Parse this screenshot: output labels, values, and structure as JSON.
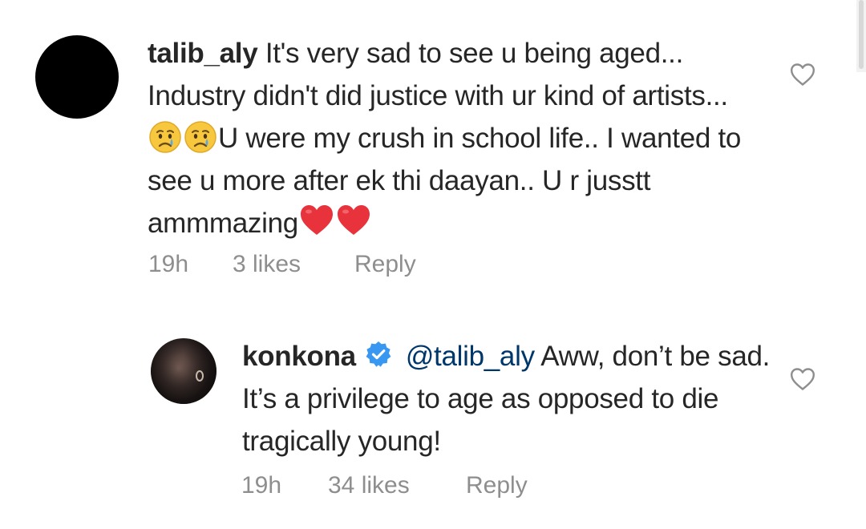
{
  "comments": [
    {
      "username": "talib_aly",
      "text": {
        "part1": "It's very sad to see u being aged... Industry didn't did justice with ur kind of artists... ",
        "part2": "U were my crush in school life.. I wanted to see u more after ek thi daayan.. U r jusstt ammmazing"
      },
      "emojis_before_part2": [
        "crying-face-emoji",
        "crying-face-emoji"
      ],
      "emojis_after_part2": [
        "red-heart-emoji",
        "red-heart-emoji"
      ],
      "time": "19h",
      "likes": "3 likes",
      "reply_label": "Reply",
      "avatar": "black-circle-avatar"
    },
    {
      "username": "konkona",
      "verified": true,
      "mention": "@talib_aly",
      "text": " Aww, don’t be sad. It’s a privilege to age as opposed to die tragically young!",
      "time": "19h",
      "likes": "34 likes",
      "reply_label": "Reply",
      "avatar": "profile-photo-avatar"
    }
  ],
  "icons": {
    "like": "heart-outline-icon",
    "verified": "verified-badge-icon"
  },
  "colors": {
    "text": "#262626",
    "meta": "#8e8e8e",
    "mention": "#00376b",
    "verified": "#3897f0",
    "heart": "#e8323c"
  }
}
